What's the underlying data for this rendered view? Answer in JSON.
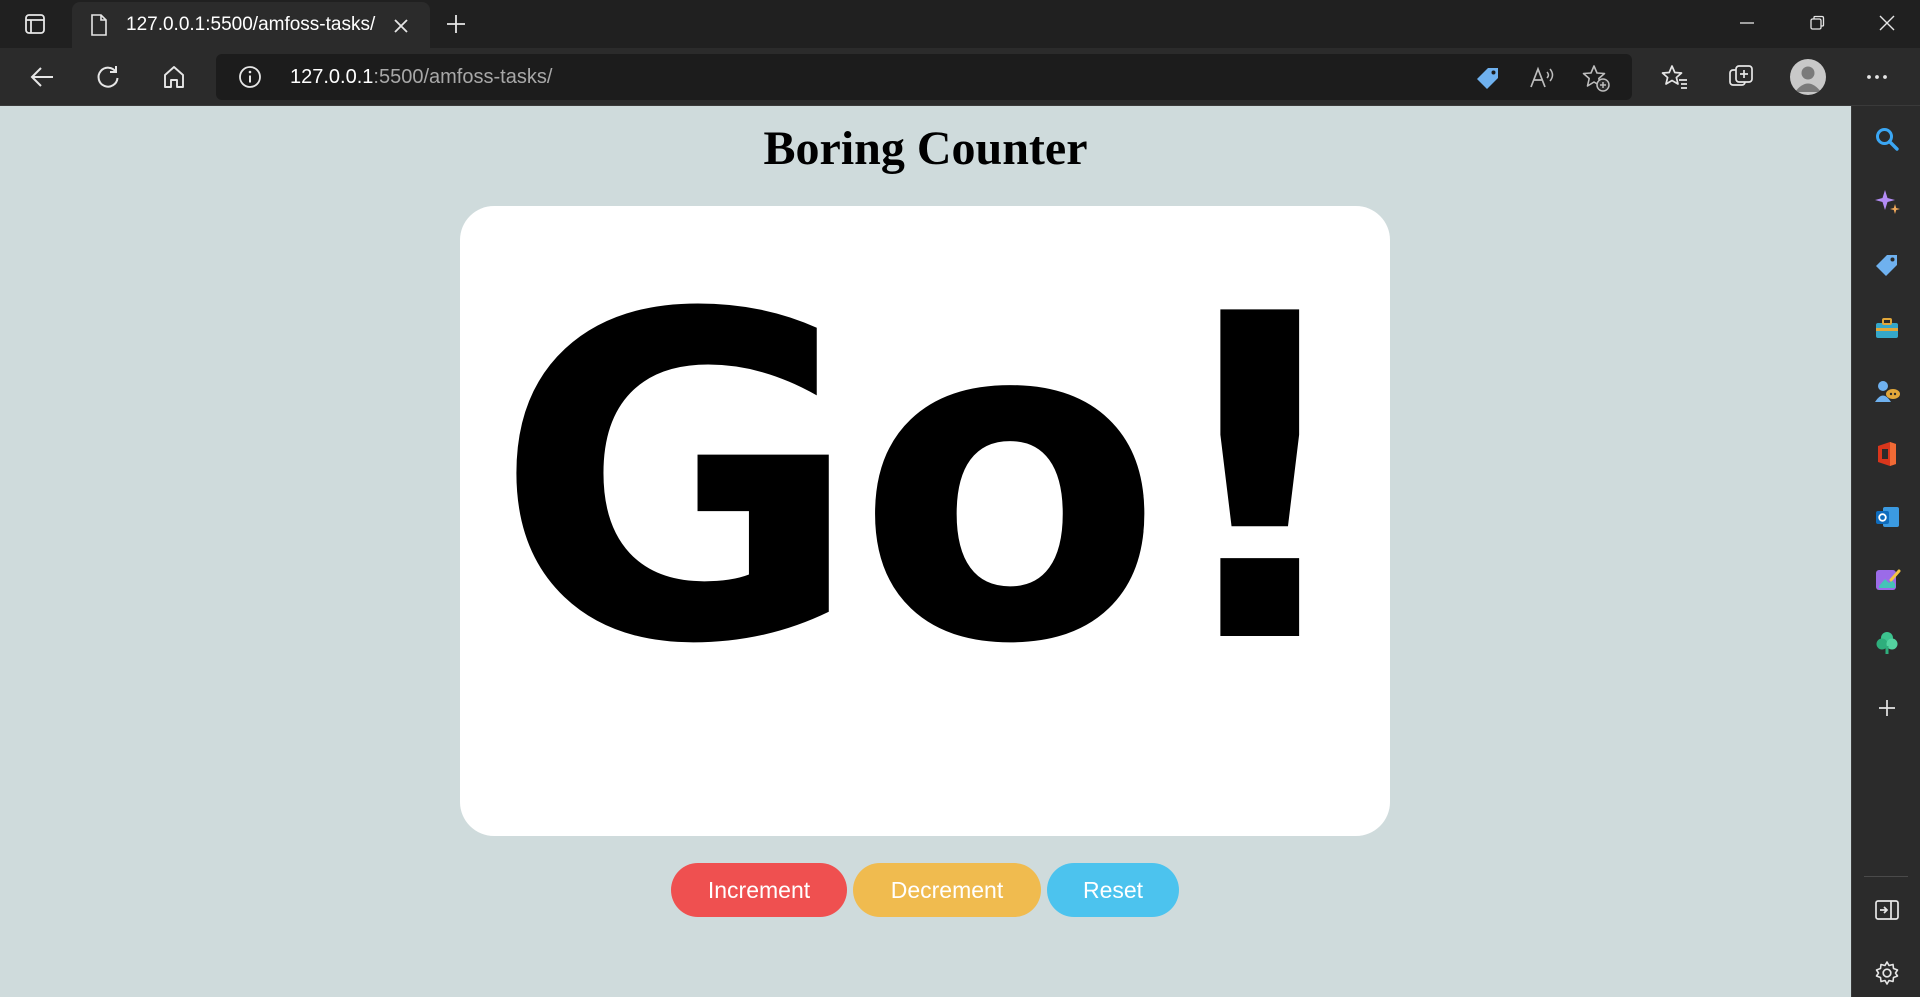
{
  "browser": {
    "tab": {
      "title": "127.0.0.1:5500/amfoss-tasks/",
      "favicon": "page-icon"
    },
    "address_bar": {
      "host": "127.0.0.1",
      "path": ":5500/amfoss-tasks/"
    },
    "toolbar_icons": [
      "back-arrow-icon",
      "refresh-icon",
      "home-icon",
      "site-info-icon",
      "tag-icon",
      "read-aloud-icon",
      "add-favorite-icon",
      "favorites-icon",
      "collections-icon",
      "profile-icon",
      "more-icon"
    ],
    "window_controls": [
      "minimize-icon",
      "restore-icon",
      "close-icon"
    ],
    "sidebar_icons": [
      "search-icon",
      "copilot-icon",
      "shopping-tag-icon",
      "tools-icon",
      "games-icon",
      "office-icon",
      "outlook-icon",
      "designer-icon",
      "tree-icon",
      "add-icon",
      "split-screen-icon",
      "settings-icon"
    ]
  },
  "page": {
    "title": "Boring Counter",
    "counter_display": "Go!",
    "buttons": {
      "increment": "Increment",
      "decrement": "Decrement",
      "reset": "Reset"
    },
    "colors": {
      "background": "#cfdbdc",
      "card": "#ffffff",
      "increment": "#ef5050",
      "decrement": "#f0bb4f",
      "reset": "#4cc3ee"
    }
  }
}
